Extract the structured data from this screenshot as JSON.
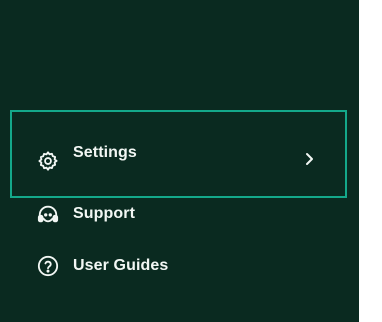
{
  "menu": {
    "items": [
      {
        "id": "settings",
        "label": "Settings",
        "icon": "gear-icon",
        "selected": true,
        "has_submenu": true
      },
      {
        "id": "support",
        "label": "Support",
        "icon": "headset-icon",
        "selected": false
      },
      {
        "id": "user-guides",
        "label": "User Guides",
        "icon": "question-circle-icon",
        "selected": false
      }
    ]
  },
  "colors": {
    "panel_background": "#0a2a20",
    "highlight_border": "#14a88a",
    "text": "#f2f7f4"
  }
}
